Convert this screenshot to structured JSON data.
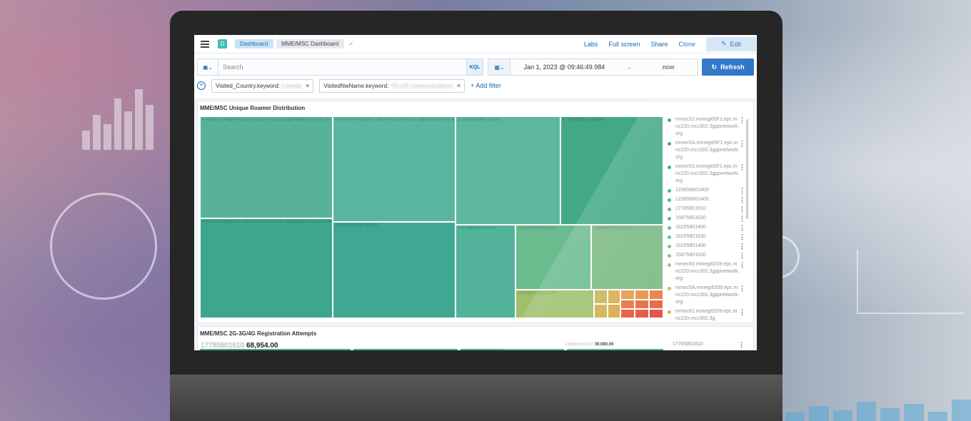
{
  "header": {
    "space_badge": "D",
    "breadcrumbs": [
      "Dashboard",
      "MME/MSC Dashboard"
    ],
    "actions": [
      "Labs",
      "Full screen",
      "Share",
      "Clone"
    ],
    "edit_label": "Edit"
  },
  "query": {
    "placeholder": "Search",
    "language": "KQL",
    "date_start": "Jan 1, 2023 @ 09:46:49.984",
    "arrow": "→",
    "date_end": "now",
    "refresh_label": "Refresh"
  },
  "filters": [
    {
      "key": "Visited_Country.keyword:",
      "value": "Canada"
    },
    {
      "key": "VisitedNwName.keyword:",
      "value": "TELUS Communications"
    }
  ],
  "add_filter_label": "+ Add filter",
  "panel1": {
    "title": "MME/MSC Unique Roamer Distribution",
    "legend": [
      {
        "label": "mmec52.mmegi05F1.epc.mnc220.mcc302.3gppnetwork.org",
        "color": "#2e9d7e"
      },
      {
        "label": "mmec5A.mmegi05F1.epc.mnc220.mcc302.3gppnetwork.org",
        "color": "#2e9d7e"
      },
      {
        "label": "mmec53.mmegi05F1.epc.mnc220.mcc302.3gppnetwork.org",
        "color": "#2e9d7e"
      },
      {
        "label": "123658801400",
        "color": "#3da88a"
      },
      {
        "label": "123658001400",
        "color": "#3da88a"
      },
      {
        "label": "17785801610",
        "color": "#48b090"
      },
      {
        "label": "15875801630",
        "color": "#48b090"
      },
      {
        "label": "16255801400",
        "color": "#5cb48e"
      },
      {
        "label": "16255801630",
        "color": "#5cb48e"
      },
      {
        "label": "16255801400",
        "color": "#6cba8a"
      },
      {
        "label": "15875801620",
        "color": "#7bbc84"
      },
      {
        "label": "mmec60.mmegi5209.epc.mnc220.mcc302.3gppnetwork.org",
        "color": "#a2c068"
      },
      {
        "label": "mmec5A.mmegi5209.epc.mnc220.mcc302.3gppnetwork.org",
        "color": "#c8b84a"
      },
      {
        "label": "mmec61.mmegi5209.epc.mnc220.mcc302.3g",
        "color": "#e0a13a"
      }
    ]
  },
  "panel2": {
    "title": "MME/MSC 2G-3G/4G Registration Attempts",
    "first_id": "17785801610",
    "first_value": "68,954.00",
    "mid_id": "128858001400",
    "mid_value": "39,080.00",
    "legend_first": "17785801610"
  },
  "treemap": [
    {
      "id": "mmec52.mmegi05F1.epc.mnc220.mcc302.3gppnetwork.org",
      "value": 79752,
      "color": "#58b29a"
    },
    {
      "id": "mmec5A.mmegi05F1.epc.mnc220.mcc302.3gppnetwork.org",
      "value": 59208,
      "color": "#5bb6a0"
    },
    {
      "id": "123658801400",
      "value": 54330,
      "color": "#5db69e"
    },
    {
      "id": "17785801610",
      "value": 13855,
      "color": "#42a888"
    },
    {
      "id": "mmec5A.mmegi05F1.epc.mnc220.mcc302.3gppnetwork.org",
      "value": 56258,
      "color": "#3ea68f"
    },
    {
      "id": "123658001400",
      "value": 16461,
      "color": "#3ea892"
    },
    {
      "id": "15875801630",
      "value": 6870,
      "color": "#52b39a"
    },
    {
      "id": "16255801400",
      "value": 5973,
      "color": "#6abb8e"
    },
    {
      "id": "16255801630",
      "value": 5718,
      "color": "#7ab984"
    },
    {
      "id": "15875801620",
      "value": 2775,
      "color": "#9ebf6c"
    }
  ]
}
